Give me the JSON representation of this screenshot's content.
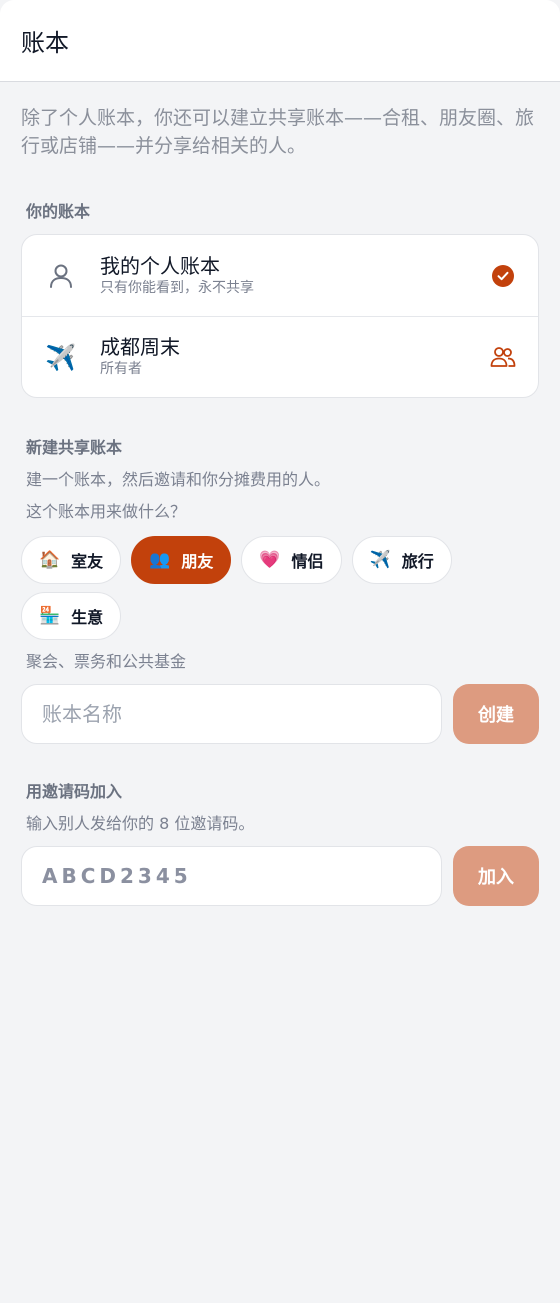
{
  "header": {
    "title": "账本"
  },
  "intro": "除了个人账本，你还可以建立共享账本——合租、朋友圈、旅行或店铺——并分享给相关的人。",
  "your_books": {
    "label": "你的账本",
    "items": [
      {
        "name": "我的个人账本",
        "subtitle": "只有你能看到，永不共享",
        "icon": "person-icon",
        "status_icon": "check-icon",
        "selected": true
      },
      {
        "name": "成都周末",
        "subtitle": "所有者",
        "emoji": "✈️",
        "icon": "airplane-icon",
        "status_icon": "group-icon"
      }
    ]
  },
  "new_book": {
    "label": "新建共享账本",
    "description": "建一个账本，然后邀请和你分摊费用的人。",
    "question": "这个账本用来做什么？",
    "categories": [
      {
        "emoji": "🏠",
        "label": "室友",
        "icon": "house-icon"
      },
      {
        "emoji": "👥",
        "label": "朋友",
        "icon": "people-icon",
        "selected": true
      },
      {
        "emoji": "💗",
        "label": "情侣",
        "icon": "heart-icon"
      },
      {
        "emoji": "✈️",
        "label": "旅行",
        "icon": "airplane-icon"
      },
      {
        "emoji": "🏪",
        "label": "生意",
        "icon": "store-icon"
      }
    ],
    "category_hint": "聚会、票务和公共基金",
    "name_placeholder": "账本名称",
    "create_label": "创建"
  },
  "join": {
    "label": "用邀请码加入",
    "description": "输入别人发给你的 8 位邀请码。",
    "code_placeholder": "ABCD2345",
    "join_label": "加入"
  },
  "colors": {
    "accent": "#c2410c",
    "button_disabled": "#dd9b80",
    "background": "#f3f4f6"
  }
}
